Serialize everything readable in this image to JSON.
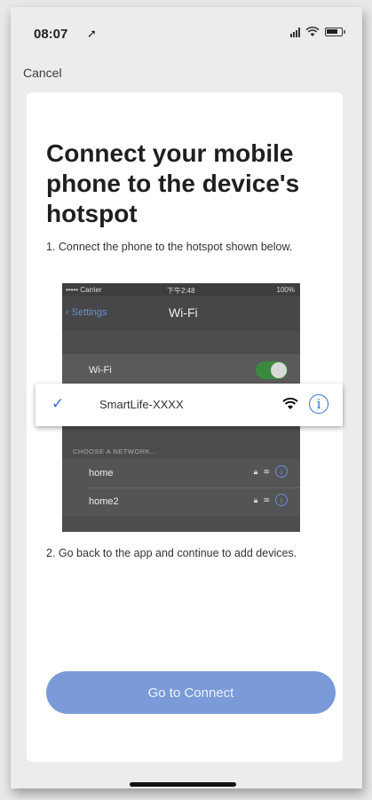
{
  "status_bar": {
    "time": "08:07",
    "location_arrow": "➚"
  },
  "nav": {
    "cancel_label": "Cancel"
  },
  "card": {
    "title": "Connect your mobile phone to the device's hotspot",
    "step1": "1. Connect the phone to the hotspot shown below.",
    "step2": "2. Go back to the app and continue to add devices.",
    "button_label": "Go to Connect"
  },
  "wifi_settings_image": {
    "carrier": "••••• Carrier",
    "time": "下午2:48",
    "battery": "100%",
    "back_label": "Settings",
    "title": "Wi-Fi",
    "wifi_row_label": "Wi-Fi",
    "choose_label": "CHOOSE A NETWORK...",
    "networks": [
      {
        "name": "home"
      },
      {
        "name": "home2"
      }
    ]
  },
  "highlight": {
    "ssid": "SmartLife-XXXX"
  },
  "colors": {
    "accent": "#2f6fd6",
    "button": "#7a9bd8"
  }
}
